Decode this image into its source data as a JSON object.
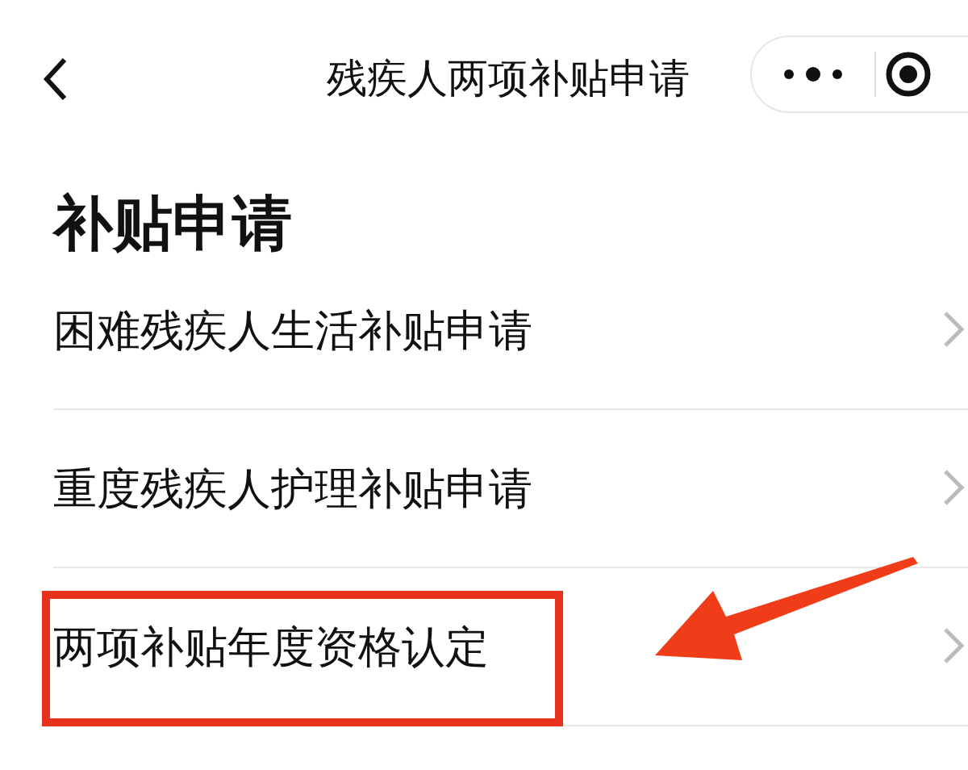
{
  "nav_bar": {
    "title": "残疾人两项补贴申请"
  },
  "section": {
    "heading": "补贴申请",
    "items": [
      {
        "label": "困难残疾人生活补贴申请",
        "highlighted": false
      },
      {
        "label": "重度残疾人护理补贴申请",
        "highlighted": false
      },
      {
        "label": "两项补贴年度资格认定",
        "highlighted": true
      }
    ]
  }
}
